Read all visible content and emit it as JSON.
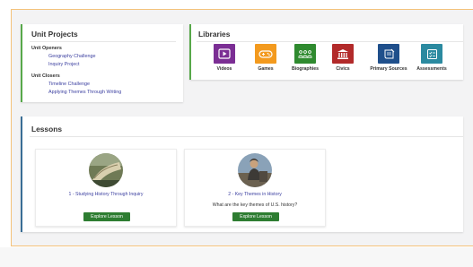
{
  "unit_projects": {
    "title": "Unit Projects",
    "groups": [
      {
        "label": "Unit Openers",
        "links": [
          "Geography Challenge",
          "Inquiry Project"
        ]
      },
      {
        "label": "Unit Closers",
        "links": [
          "Timeline Challenge",
          "Applying Themes Through Writing"
        ]
      }
    ]
  },
  "libraries": {
    "title": "Libraries",
    "items": [
      {
        "label": "Videos",
        "icon": "play-icon",
        "color": "#7b2e94"
      },
      {
        "label": "Games",
        "icon": "gamepad-icon",
        "color": "#f39a1e"
      },
      {
        "label": "Biographies",
        "icon": "people-icon",
        "color": "#2f8a2f"
      },
      {
        "label": "Civics",
        "icon": "building-icon",
        "color": "#b22a2a"
      },
      {
        "label": "Primary Sources",
        "icon": "document-icon",
        "color": "#1f4f8b"
      },
      {
        "label": "Assessments",
        "icon": "checklist-icon",
        "color": "#2b8aa0"
      }
    ]
  },
  "lessons": {
    "title": "Lessons",
    "cards": [
      {
        "title": "1 - Studying History Through Inquiry",
        "question": "",
        "button": "Explore Lesson"
      },
      {
        "title": "2 - Key Themes in History",
        "question": "What are the key themes of U.S. history?",
        "button": "Explore Lesson"
      }
    ]
  },
  "colors": {
    "accent_green": "#57a84a",
    "lessons_accent": "#3a6e96",
    "button_green": "#2e7d32",
    "link_purple": "#3b3fa0",
    "frame_orange": "#f4c27a"
  }
}
